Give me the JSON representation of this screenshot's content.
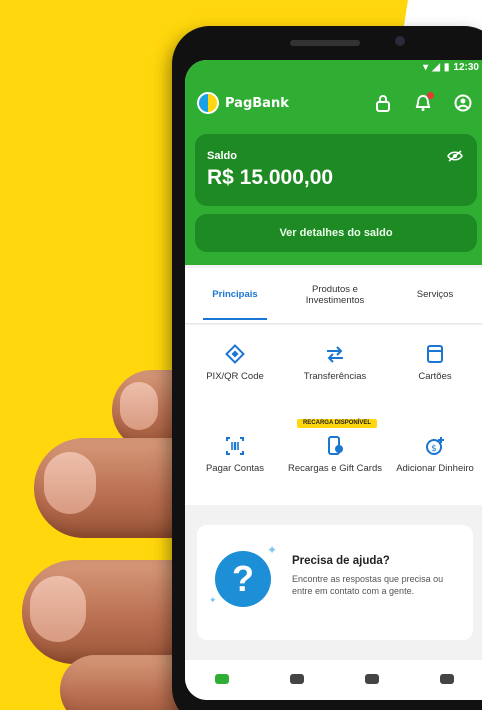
{
  "status_bar": {
    "time": "12:30"
  },
  "app": {
    "name": "PagBank"
  },
  "balance": {
    "label": "Saldo",
    "value": "R$ 15.000,00"
  },
  "details_button": "Ver detalhes do saldo",
  "tabs": [
    {
      "label": "Principais",
      "active": true
    },
    {
      "label": "Produtos e Investimentos",
      "active": false
    },
    {
      "label": "Serviços",
      "active": false
    }
  ],
  "actions": [
    {
      "label": "PIX/QR Code",
      "icon": "pix-icon"
    },
    {
      "label": "Transferências",
      "icon": "transfer-icon"
    },
    {
      "label": "Cartões",
      "icon": "card-icon"
    },
    {
      "label": "Pagar Contas",
      "icon": "barcode-icon"
    },
    {
      "label": "Recargas e Gift Cards",
      "icon": "phone-recharge-icon",
      "badge": "RECARGA DISPONÍVEL"
    },
    {
      "label": "Adicionar Dinheiro",
      "icon": "add-money-icon"
    }
  ],
  "help": {
    "title": "Precisa de ajuda?",
    "text": "Encontre as respostas que precisa ou entre em contato com a gente."
  },
  "colors": {
    "brand_yellow": "#ffd70c",
    "brand_green": "#2fae33",
    "dark_green": "#1e8a24",
    "accent_blue": "#1976d2"
  }
}
